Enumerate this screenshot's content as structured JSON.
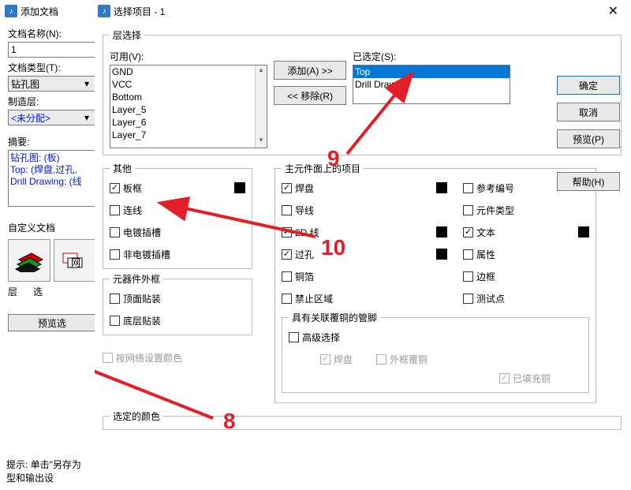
{
  "addDoc": {
    "title": "添加文档",
    "docNameLbl": "文档名称(N):",
    "docName": "1",
    "docTypeLbl": "文档类型(T):",
    "docType": "钻孔图",
    "fabLayerLbl": "制造层:",
    "fabLayer": "<未分配>",
    "summaryLbl": "摘要:",
    "summary1": "钻孔图: (板)",
    "summary2": "Top: (焊盘,过孔,",
    "summary3": "Drill Drawing: (线",
    "customLbl": "自定义文档",
    "layerBtn": "层",
    "optBtn": "选",
    "previewBtn": "预览选",
    "hint": "提示: 单击\"另存为\n    型和输出设"
  },
  "select": {
    "title": "选择项目 - 1",
    "layerGroup": "层选择",
    "availLbl": "可用(V):",
    "avail": [
      "GND",
      "VCC",
      "Bottom",
      "Layer_5",
      "Layer_6",
      "Layer_7"
    ],
    "addBtn": "添加(A) >>",
    "removeBtn": "<< 移除(R)",
    "selectedLbl": "已选定(S):",
    "selected": [
      "Top",
      "Drill Drawing"
    ],
    "otherGroup": "其他",
    "other": {
      "frame": "板框",
      "lines": "连线",
      "platedSlot": "电镀插槽",
      "nonPlatedSlot": "非电镀插槽"
    },
    "compOutlineGroup": "元器件外框",
    "compOutline": {
      "top": "顶面贴装",
      "bottom": "底层贴装"
    },
    "primaryGroup": "主元件面上的项目",
    "primary": {
      "pad": "焊盘",
      "trace": "导线",
      "line2d": "2D 线",
      "via": "过孔",
      "copper": "铜箔",
      "keepout": "禁止区域",
      "refdes": "参考编号",
      "compType": "元件类型",
      "text": "文本",
      "attr": "属性",
      "outline": "边框",
      "testpt": "测试点"
    },
    "assocGroup": "具有关联覆铜的管脚",
    "advanced": "高级选择",
    "assoc": {
      "pad": "焊盘",
      "outer": "外框覆铜",
      "filled": "已填充铜"
    },
    "byNet": "按网络设置颜色",
    "selColorGroup": "选定的颜色",
    "buttons": {
      "ok": "确定",
      "cancel": "取消",
      "preview": "预览(P)",
      "help": "帮助(H)"
    }
  },
  "anno": {
    "n8": "8",
    "n9": "9",
    "n10": "10"
  }
}
